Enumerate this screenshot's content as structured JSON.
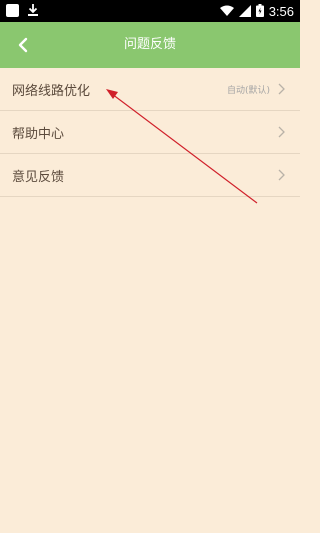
{
  "status_bar": {
    "time": "3:56"
  },
  "header": {
    "title": "问题反馈"
  },
  "list": {
    "items": [
      {
        "label": "网络线路优化",
        "value": "自动(默认)"
      },
      {
        "label": "帮助中心",
        "value": ""
      },
      {
        "label": "意见反馈",
        "value": ""
      }
    ]
  },
  "colors": {
    "header_bg": "#8ac76f",
    "page_bg": "#fbecd8",
    "annotation_arrow": "#d0202a"
  }
}
